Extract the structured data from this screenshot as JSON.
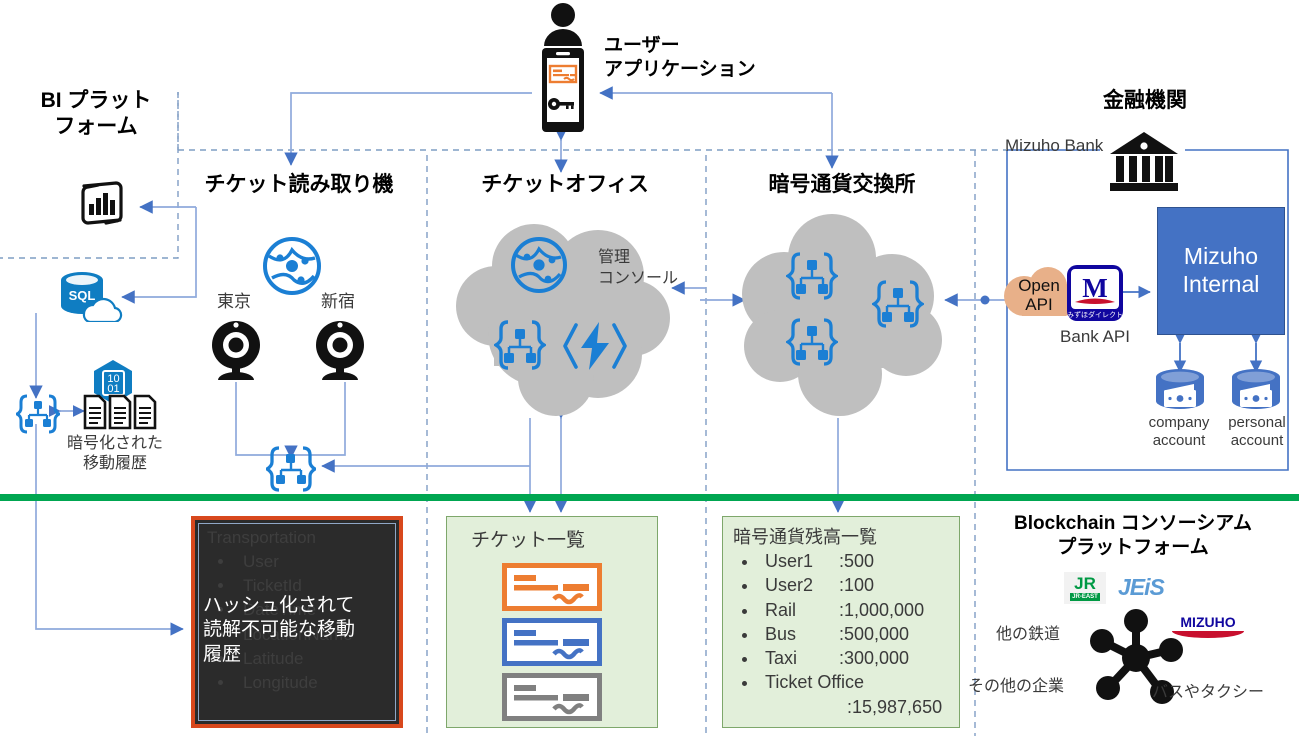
{
  "sections": {
    "bi_platform": "BI プラット\nフォーム",
    "ticket_reader": "チケット読み取り機",
    "ticket_office": "チケットオフィス",
    "crypto_exchange": "暗号通貨交換所",
    "financial_institution": "金融機関",
    "user_application": "ユーザー\nアプリケーション",
    "blockchain_consortium": "Blockchain コンソーシアム\nプラットフォーム"
  },
  "bi": {
    "powerbi_icon": "powerbi-icon",
    "sql_icon": "azure-sql-database-icon",
    "blockchain_icon": "blockchain-service-icon",
    "hex_binary_icon": "encrypted-data-icon",
    "documents_icon": "documents-icon",
    "encrypted_history_label": "暗号化された\n移動履歴"
  },
  "reader": {
    "network_icon": "network-mesh-icon",
    "stations": [
      {
        "name": "東京",
        "icon": "camera-reader-icon"
      },
      {
        "name": "新宿",
        "icon": "camera-reader-icon"
      }
    ],
    "blockchain_icon": "blockchain-service-icon"
  },
  "office": {
    "cloud_icon": "cloud-icon",
    "network_icon": "network-mesh-icon",
    "console_label": "管理\nコンソール",
    "blockchain_icon": "blockchain-service-icon",
    "functions_icon": "azure-functions-icon"
  },
  "exchange": {
    "cloud_icon": "cloud-icon",
    "node_icons": [
      "blockchain-service-icon",
      "blockchain-service-icon",
      "blockchain-service-icon"
    ]
  },
  "finance": {
    "bank_label": "Mizuho Bank",
    "bank_icon": "bank-building-icon",
    "open_api": "Open\nAPI",
    "open_api_icon": "cloud-icon",
    "bank_api_label": "Bank API",
    "bank_api_icon": "mizuho-direct-m-icon",
    "bank_api_icon_sub": "みずほダイレクト",
    "internal_label": "Mizuho\nInternal",
    "internal_color": "#4472C4",
    "accounts": [
      {
        "label": "company\naccount",
        "icon": "account-database-icon"
      },
      {
        "label": "personal\naccount",
        "icon": "account-database-icon"
      }
    ]
  },
  "user_app": {
    "person_icon": "person-icon",
    "phone_icon": "smartphone-icon",
    "ticket_icon": "ticket-icon",
    "key_icon": "key-icon"
  },
  "transportation_record": {
    "header": "Transportation",
    "items": [
      "User",
      "TicketId",
      "DateTime",
      "LocationName",
      "Latitude",
      "Longitude"
    ],
    "overlay_text": "ハッシュ化されて\n読解不可能な移動\n履歴",
    "border_color": "#D8481D",
    "background_color": "#2B2B2B"
  },
  "ticket_list": {
    "title": "チケット一覧",
    "tickets": [
      {
        "color": "#ED7D31",
        "icon": "ticket-icon"
      },
      {
        "color": "#4472C4",
        "icon": "ticket-icon"
      },
      {
        "color": "#808080",
        "icon": "ticket-icon"
      }
    ],
    "background_color": "#E2EFDA"
  },
  "balance_list": {
    "title": "暗号通貨残高一覧",
    "entries": [
      {
        "name": "User1",
        "value": ":500"
      },
      {
        "name": "User2",
        "value": ":100"
      },
      {
        "name": "Rail",
        "value": ":1,000,000"
      },
      {
        "name": "Bus",
        "value": ":500,000"
      },
      {
        "name": "Taxi",
        "value": ":300,000"
      },
      {
        "name": "Ticket Office",
        "value": ":15,987,650",
        "wrap": true
      }
    ],
    "background_color": "#E2EFDA"
  },
  "consortium": {
    "hub_icon": "network-hub-icon",
    "logos": [
      {
        "name": "jr-east-logo",
        "text": "JR",
        "sub": "JR-EAST"
      },
      {
        "name": "jeis-logo",
        "text": "JEiS"
      },
      {
        "name": "mizuho-logo",
        "text": "MIZUHO"
      }
    ],
    "labels": {
      "other_rail": "他の鉄道",
      "other_corp": "その他の企業",
      "bus_taxi": "バスやタクシー"
    }
  },
  "colors": {
    "green_divider": "#00A651",
    "connector_blue": "#8FAADC",
    "arrow_blue": "#4472C4",
    "azure_blue": "#0F7DC2",
    "cloud_gray": "#BFBFBF",
    "open_api_peach": "#E8B089"
  }
}
